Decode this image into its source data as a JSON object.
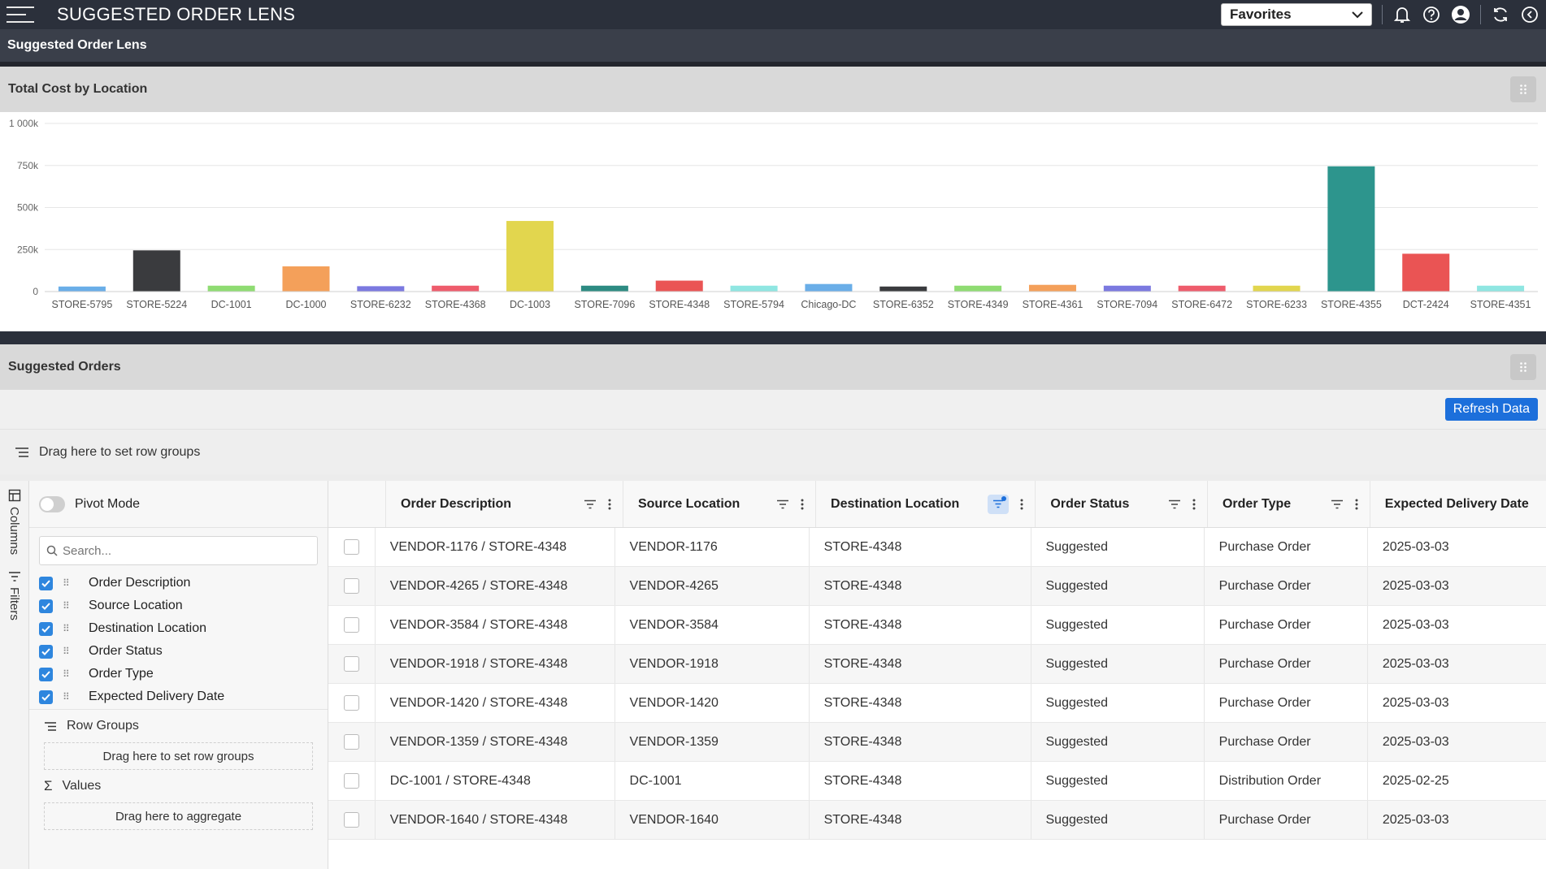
{
  "app": {
    "title": "SUGGESTED ORDER LENS",
    "subtitle": "Suggested Order Lens",
    "favorites_label": "Favorites"
  },
  "icons": [
    "menu-icon",
    "chevron-down-icon",
    "bell-icon",
    "help-icon",
    "user-icon",
    "refresh-icon",
    "logout-icon",
    "grip-icon",
    "row-group-icon",
    "columns-icon",
    "filter-icon",
    "search-icon",
    "sigma-icon",
    "more-vertical-icon",
    "check-icon"
  ],
  "chart_panel": {
    "title": "Total Cost by Location"
  },
  "chart_data": {
    "type": "bar",
    "categories": [
      "STORE-5795",
      "STORE-5224",
      "DC-1001",
      "DC-1000",
      "STORE-6232",
      "STORE-4368",
      "DC-1003",
      "STORE-7096",
      "STORE-4348",
      "STORE-5794",
      "Chicago-DC",
      "STORE-6352",
      "STORE-4349",
      "STORE-4361",
      "STORE-7094",
      "STORE-6472",
      "STORE-6233",
      "STORE-4355",
      "DCT-2424",
      "STORE-4351"
    ],
    "values": [
      30000,
      245000,
      35000,
      150000,
      32000,
      35000,
      420000,
      35000,
      65000,
      35000,
      45000,
      30000,
      35000,
      40000,
      35000,
      35000,
      35000,
      745000,
      225000,
      35000
    ],
    "colors": [
      "#6aaee8",
      "#3a3b3e",
      "#8fdc72",
      "#f4a05a",
      "#7b79e0",
      "#ee5c6c",
      "#e2d64e",
      "#2d8b82",
      "#ea5454",
      "#8fe6e2",
      "#6aaee8",
      "#3a3b3e",
      "#8fdc72",
      "#f4a05a",
      "#7b79e0",
      "#ee5c6c",
      "#e2d64e",
      "#2d958d",
      "#ea5454",
      "#8fe6e2"
    ],
    "y_ticks": [
      "0",
      "250k",
      "500k",
      "750k",
      "1 000k"
    ],
    "ylim": [
      0,
      1000000
    ],
    "grid": true,
    "xlabel": "",
    "ylabel": ""
  },
  "orders_panel": {
    "title": "Suggested Orders",
    "refresh_label": "Refresh Data",
    "row_groups_hint": "Drag here to set row groups"
  },
  "tool_panel": {
    "tabs": [
      "Columns",
      "Filters"
    ],
    "pivot_label": "Pivot Mode",
    "search_placeholder": "Search...",
    "columns": [
      "Order Description",
      "Source Location",
      "Destination Location",
      "Order Status",
      "Order Type",
      "Expected Delivery Date"
    ],
    "row_groups_label": "Row Groups",
    "row_groups_drop": "Drag here to set row groups",
    "values_label": "Values",
    "values_drop": "Drag here to aggregate"
  },
  "grid": {
    "headers": [
      "Order Description",
      "Source Location",
      "Destination Location",
      "Order Status",
      "Order Type",
      "Expected Delivery Date"
    ],
    "rows": [
      [
        "VENDOR-1176 / STORE-4348",
        "VENDOR-1176",
        "STORE-4348",
        "Suggested",
        "Purchase Order",
        "2025-03-03"
      ],
      [
        "VENDOR-4265 / STORE-4348",
        "VENDOR-4265",
        "STORE-4348",
        "Suggested",
        "Purchase Order",
        "2025-03-03"
      ],
      [
        "VENDOR-3584 / STORE-4348",
        "VENDOR-3584",
        "STORE-4348",
        "Suggested",
        "Purchase Order",
        "2025-03-03"
      ],
      [
        "VENDOR-1918 / STORE-4348",
        "VENDOR-1918",
        "STORE-4348",
        "Suggested",
        "Purchase Order",
        "2025-03-03"
      ],
      [
        "VENDOR-1420 / STORE-4348",
        "VENDOR-1420",
        "STORE-4348",
        "Suggested",
        "Purchase Order",
        "2025-03-03"
      ],
      [
        "VENDOR-1359 / STORE-4348",
        "VENDOR-1359",
        "STORE-4348",
        "Suggested",
        "Purchase Order",
        "2025-03-03"
      ],
      [
        "DC-1001 / STORE-4348",
        "DC-1001",
        "STORE-4348",
        "Suggested",
        "Distribution Order",
        "2025-02-25"
      ],
      [
        "VENDOR-1640 / STORE-4348",
        "VENDOR-1640",
        "STORE-4348",
        "Suggested",
        "Purchase Order",
        "2025-03-03"
      ]
    ]
  }
}
